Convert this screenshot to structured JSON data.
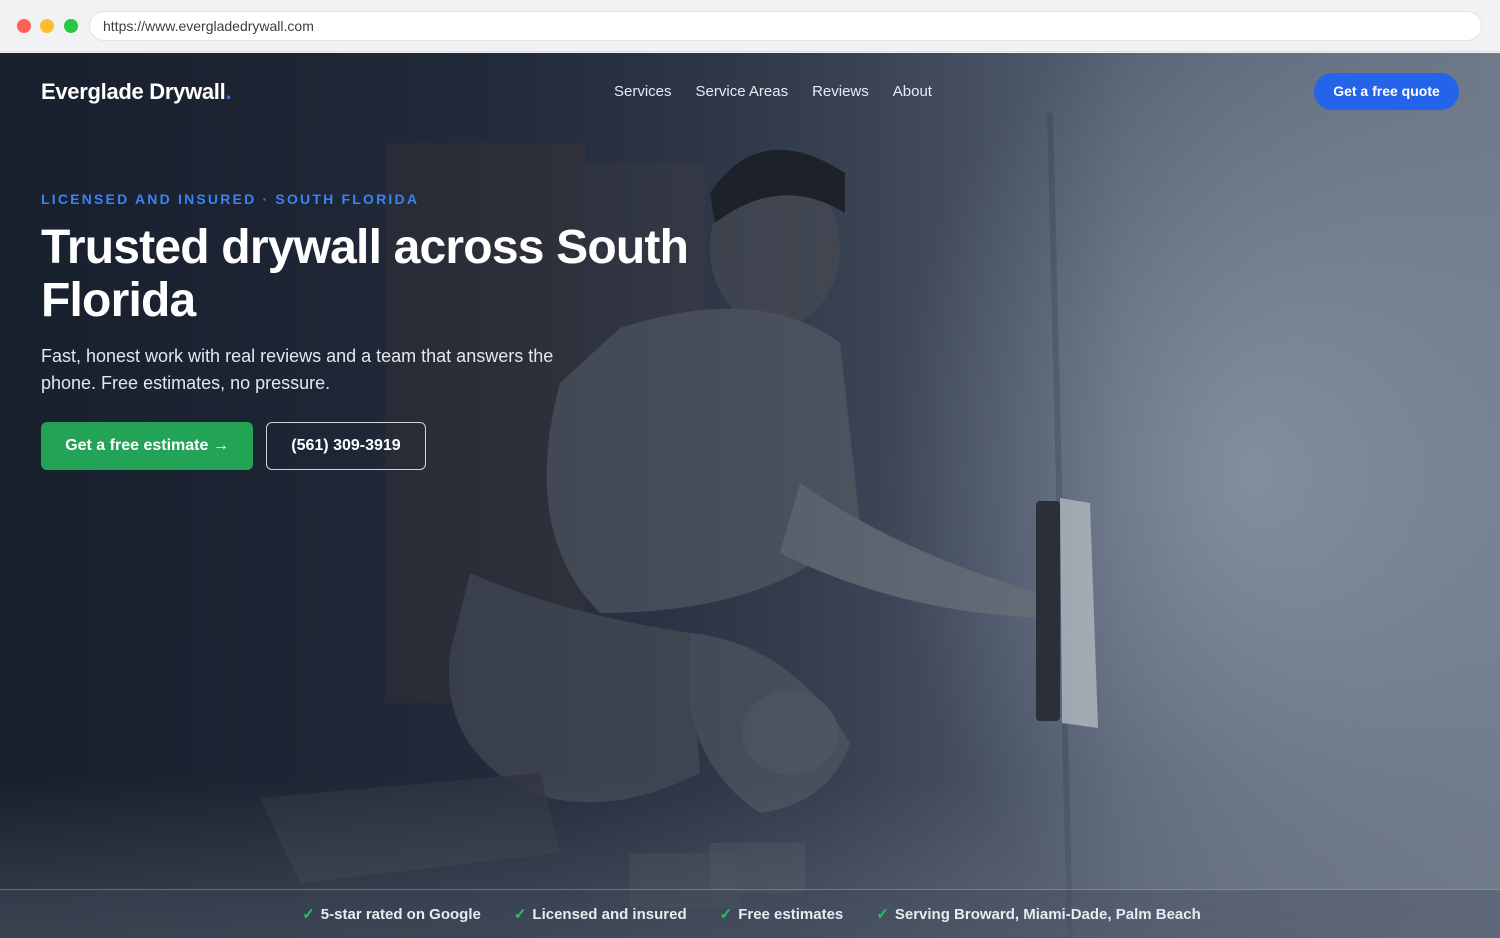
{
  "browser": {
    "url": "https://www.evergladedrywall.com"
  },
  "header": {
    "logo_text": "Everglade Drywall",
    "logo_dot": ".",
    "nav": [
      {
        "label": "Services"
      },
      {
        "label": "Service Areas"
      },
      {
        "label": "Reviews"
      },
      {
        "label": "About"
      }
    ],
    "cta_label": "Get a free quote"
  },
  "hero": {
    "eyebrow": "LICENSED AND INSURED · SOUTH FLORIDA",
    "headline": "Trusted drywall across South Florida",
    "subheadline": "Fast, honest work with real reviews and a team that answers the phone. Free estimates, no pressure.",
    "primary_cta": "Get a free estimate →",
    "phone_cta": "(561) 309-3919"
  },
  "trust_bar": {
    "check_icon": "✓",
    "items": [
      {
        "label": "5-star rated on Google"
      },
      {
        "label": "Licensed and insured"
      },
      {
        "label": "Free estimates"
      },
      {
        "label": "Serving Broward, Miami-Dade, Palm Beach"
      }
    ]
  },
  "colors": {
    "accent_blue": "#2563eb",
    "eyebrow_blue": "#3b82f6",
    "cta_green": "#22a356",
    "check_green": "#22c55e"
  }
}
